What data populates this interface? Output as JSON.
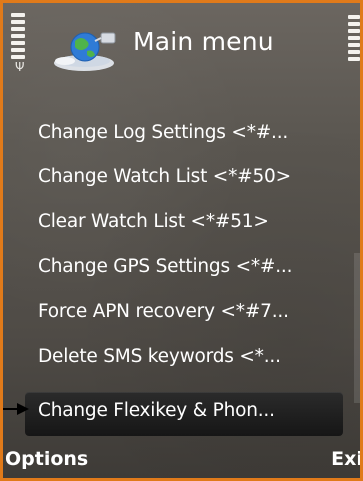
{
  "header": {
    "title": "Main menu",
    "icon": "globe-satellite-icon"
  },
  "status": {
    "signal_icon": "signal-strength-icon",
    "battery_icon": "battery-level-icon"
  },
  "menu": {
    "items": [
      {
        "label": "Change Log Settings <*#..."
      },
      {
        "label": "Change Watch List <*#50>"
      },
      {
        "label": "Clear Watch List <*#51>"
      },
      {
        "label": "Change GPS Settings <*#..."
      },
      {
        "label": "Force APN recovery <*#7..."
      },
      {
        "label": "Delete SMS keywords <*..."
      },
      {
        "label": "Change Flexikey & Phon..."
      }
    ],
    "selected_index": 6
  },
  "softkeys": {
    "left": "Options",
    "right": "Exit"
  },
  "colors": {
    "frame_border": "#e07a1a",
    "background": "#5a5650",
    "text": "#ffffff",
    "selection": "#161616"
  }
}
